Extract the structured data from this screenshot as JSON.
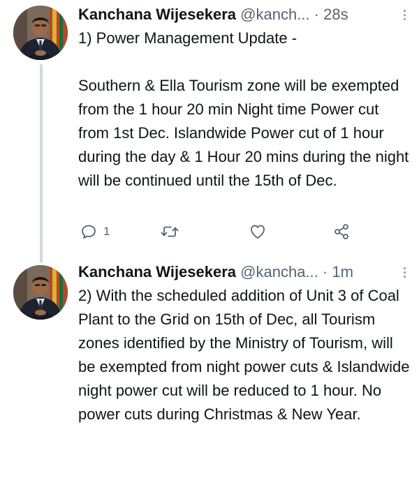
{
  "tweets": [
    {
      "author_name": "Kanchana Wijesekera",
      "handle": "@kanch...",
      "separator": "·",
      "time": "28s",
      "text": "1) Power Management Update -\n\nSouthern & Ella Tourism zone will be exempted from the 1 hour 20 min Night time Power cut from 1st Dec. Islandwide Power cut of 1 hour during the day & 1 Hour 20 mins during the night will be continued until the 15th of Dec.",
      "actions": {
        "reply_count": "1",
        "reply_icon": "reply-icon",
        "retweet_icon": "retweet-icon",
        "like_icon": "heart-icon",
        "share_icon": "share-icon"
      }
    },
    {
      "author_name": "Kanchana Wijesekera",
      "handle": "@kancha...",
      "separator": "·",
      "time": "1m",
      "text": "2) With the scheduled addition of Unit 3 of Coal Plant to the Grid on 15th of Dec, all Tourism zones identified by the Ministry of Tourism, will be exempted from night power cuts & Islandwide night power cut will be reduced to 1 hour. No power cuts during Christmas & New Year."
    }
  ],
  "colors": {
    "text_primary": "#0f1419",
    "text_secondary": "#536471",
    "thread_line": "#cfd9de"
  }
}
